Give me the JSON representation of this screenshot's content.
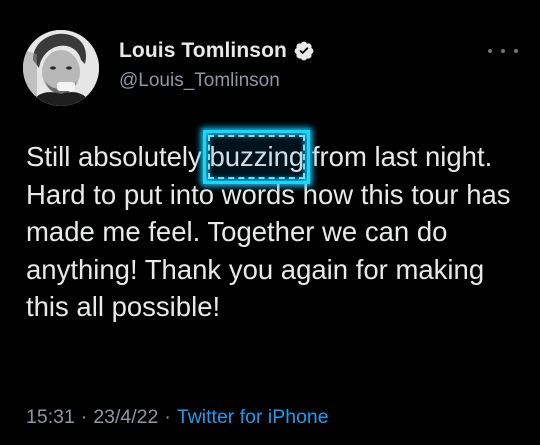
{
  "author": {
    "display_name": "Louis Tomlinson",
    "handle": "@Louis_Tomlinson",
    "verified": true,
    "verified_color": "#1d9bf0"
  },
  "tweet": {
    "text_before": "Still absolutely ",
    "highlighted_word": "buzzing",
    "text_after": " from last night. Hard to put into words how this tour has made me feel. Together we can do anything! Thank you again for making this all possible!",
    "highlight_color": "#19d7f5"
  },
  "meta": {
    "time": "15:31",
    "separator_1": "·",
    "date": "23/4/22",
    "separator_2": "·",
    "source": "Twitter for iPhone",
    "source_color": "#1d9bf0"
  },
  "icons": {
    "more": "more-horizontal-icon",
    "verified": "verified-badge-icon"
  },
  "colors": {
    "background": "#000000",
    "primary_text": "#e7e9ea",
    "secondary_text": "#8b98a5"
  }
}
